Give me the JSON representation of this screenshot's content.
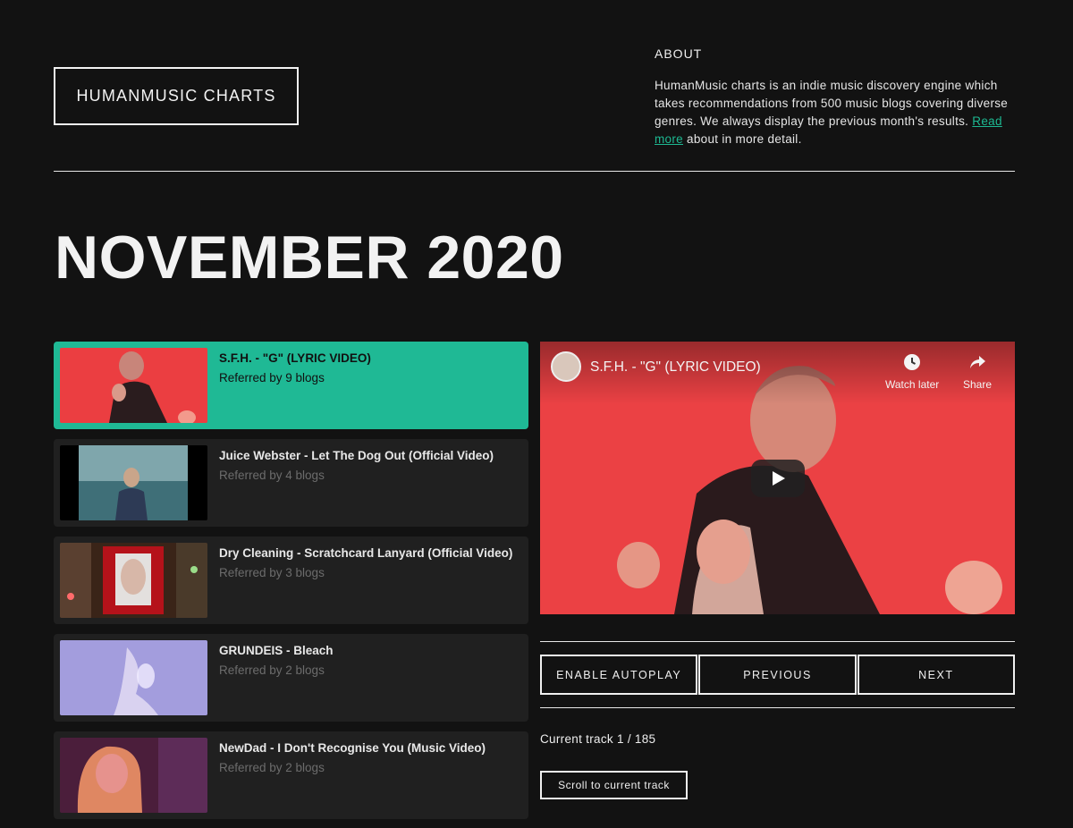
{
  "header": {
    "logo": "HUMANMUSIC CHARTS",
    "about_title": "ABOUT",
    "about_text": "HumanMusic charts is an indie music discovery engine which takes recommendations from 500 music blogs covering diverse genres. We always display the previous month's results.",
    "about_link": "Read more",
    "about_tail": "about in more detail."
  },
  "month_title": "NOVEMBER 2020",
  "tracks": [
    {
      "title": "S.F.H. - \"G\" (LYRIC VIDEO)",
      "sub": "Referred by 9 blogs"
    },
    {
      "title": "Juice Webster - Let The Dog Out (Official Video)",
      "sub": "Referred by 4 blogs"
    },
    {
      "title": "Dry Cleaning - Scratchcard Lanyard (Official Video)",
      "sub": "Referred by 3 blogs"
    },
    {
      "title": "GRUNDEIS - Bleach",
      "sub": "Referred by 2 blogs"
    },
    {
      "title": "NewDad - I Don't Recognise You (Music Video)",
      "sub": "Referred by 2 blogs"
    }
  ],
  "player": {
    "title": "S.F.H. - \"G\" (LYRIC VIDEO)",
    "watch_later": "Watch later",
    "share": "Share"
  },
  "controls": {
    "autoplay": "ENABLE AUTOPLAY",
    "previous": "PREVIOUS",
    "next": "NEXT"
  },
  "current_track": "Current track 1 / 185",
  "scroll_button": "Scroll to current track",
  "colors": {
    "background": "#121212",
    "accent": "#1fb995",
    "card": "#202020"
  }
}
